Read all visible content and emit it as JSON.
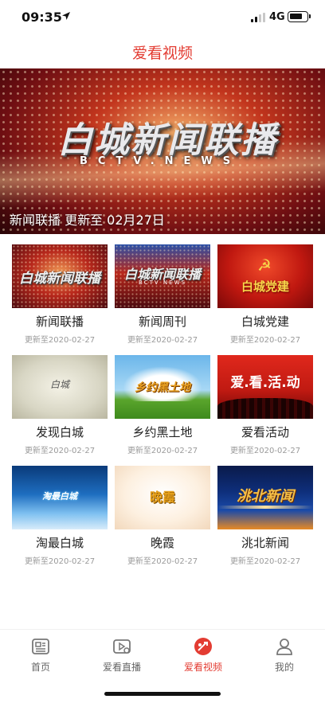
{
  "status_bar": {
    "time": "09:35",
    "network": "4G"
  },
  "nav": {
    "title": "爱看视频"
  },
  "banner": {
    "logo_text": "白城新闻联播",
    "logo_sub": "BCTV.NEWS",
    "caption": "新闻联播 更新至 02月27日"
  },
  "grid": [
    {
      "title": "新闻联播",
      "date": "更新至2020-02-27",
      "thumb_text": "白城新闻联播",
      "thumb_sub": ""
    },
    {
      "title": "新闻周刊",
      "date": "更新至2020-02-27",
      "thumb_text": "白城新闻联播",
      "thumb_sub": "BCTV NEWS"
    },
    {
      "title": "白城党建",
      "date": "更新至2020-02-27",
      "thumb_text": "白城党建",
      "thumb_sub": ""
    },
    {
      "title": "发现白城",
      "date": "更新至2020-02-27",
      "thumb_text": "白城",
      "thumb_sub": ""
    },
    {
      "title": "乡约黑土地",
      "date": "更新至2020-02-27",
      "thumb_text": "乡约黑土地",
      "thumb_sub": ""
    },
    {
      "title": "爱看活动",
      "date": "更新至2020-02-27",
      "thumb_text": "爱.看.活.动",
      "thumb_sub": ""
    },
    {
      "title": "淘最白城",
      "date": "更新至2020-02-27",
      "thumb_text": "淘最白城",
      "thumb_sub": ""
    },
    {
      "title": "晚霞",
      "date": "更新至2020-02-27",
      "thumb_text": "晚霞",
      "thumb_sub": ""
    },
    {
      "title": "洮北新闻",
      "date": "更新至2020-02-27",
      "thumb_text": "洮北新闻",
      "thumb_sub": ""
    }
  ],
  "tabbar": {
    "items": [
      {
        "label": "首页",
        "icon": "news-icon"
      },
      {
        "label": "爱看直播",
        "icon": "live-tv-icon"
      },
      {
        "label": "爱看视频",
        "icon": "video-icon",
        "active": true
      },
      {
        "label": "我的",
        "icon": "user-icon"
      }
    ]
  },
  "colors": {
    "accent": "#e33c32",
    "muted": "#9a9a9a"
  }
}
